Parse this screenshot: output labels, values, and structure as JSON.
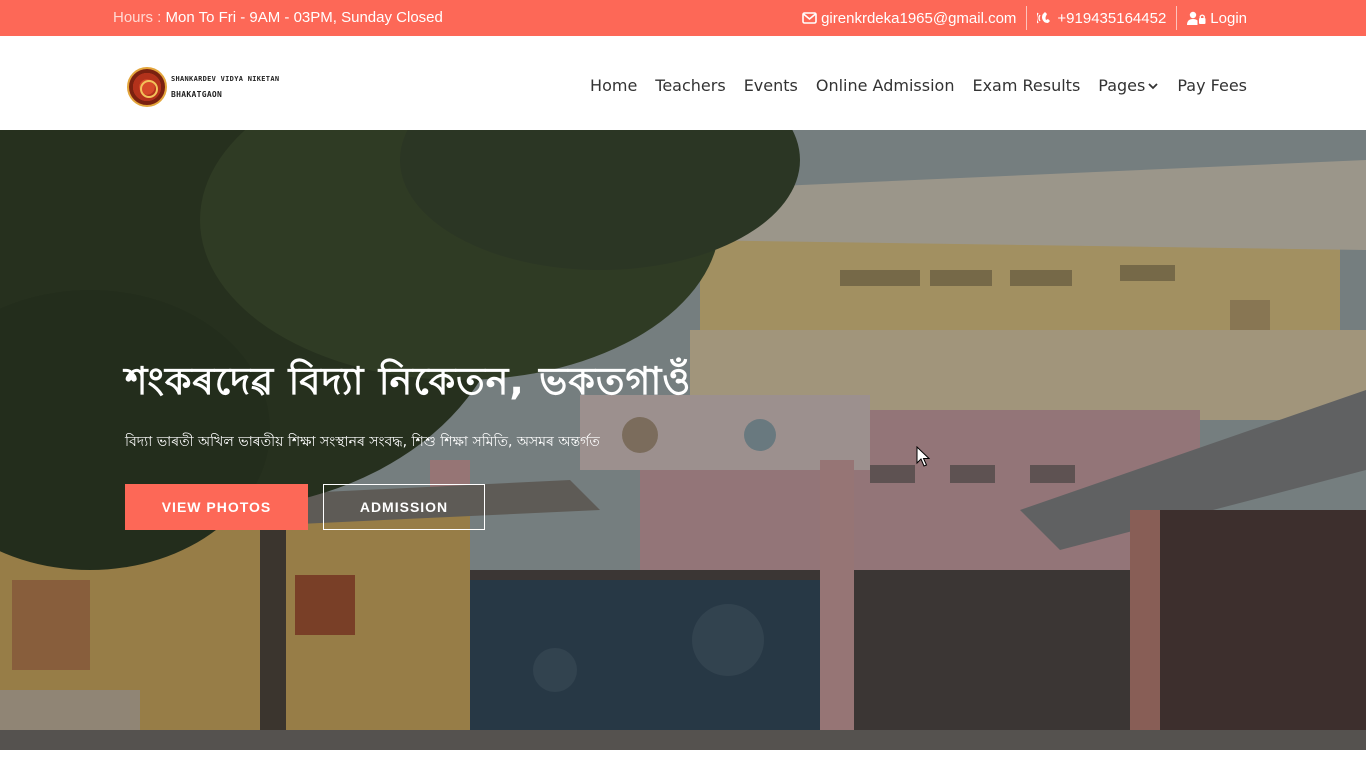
{
  "topbar": {
    "hours_label": "Hours : ",
    "hours_value": "Mon To Fri - 9AM - 03PM, Sunday Closed",
    "email": "girenkrdeka1965@gmail.com",
    "phone": "+919435164452",
    "login": "Login"
  },
  "brand": {
    "line1": "SHANKARDEV VIDYA NIKETAN",
    "line2": "BHAKATGAON"
  },
  "nav": {
    "items": [
      "Home",
      "Teachers",
      "Events",
      "Online Admission",
      "Exam Results",
      "Pages",
      "Pay Fees"
    ]
  },
  "hero": {
    "title": "শংকৰদেৱ বিদ্যা নিকেতন, ভকতগাওঁ",
    "subtitle": "বিদ্যা ভাৰতী অখিল ভাৰতীয় শিক্ষা সংস্থানৰ সংবদ্ধ, শিশু শিক্ষা সমিতি, অসমৰ অন্তৰ্গত",
    "button_photos": "VIEW PHOTOS",
    "button_admission": "ADMISSION"
  },
  "colors": {
    "accent": "#fd6857",
    "nav_text": "#333333"
  },
  "icons": [
    "envelope-icon",
    "phone-volume-icon",
    "user-lock-icon",
    "chevron-down-icon"
  ]
}
